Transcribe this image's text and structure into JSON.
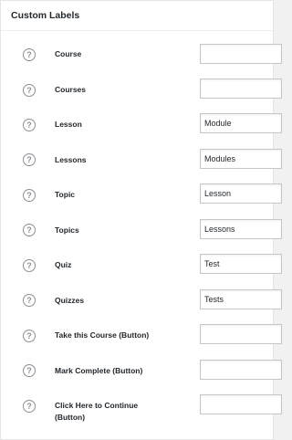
{
  "header": {
    "title": "Custom Labels"
  },
  "help_glyph": "?",
  "rows": [
    {
      "label": "Course",
      "value": ""
    },
    {
      "label": "Courses",
      "value": ""
    },
    {
      "label": "Lesson",
      "value": "Module"
    },
    {
      "label": "Lessons",
      "value": "Modules"
    },
    {
      "label": "Topic",
      "value": "Lesson"
    },
    {
      "label": "Topics",
      "value": "Lessons"
    },
    {
      "label": "Quiz",
      "value": "Test"
    },
    {
      "label": "Quizzes",
      "value": "Tests"
    },
    {
      "label": "Take this Course (Button)",
      "value": ""
    },
    {
      "label": "Mark Complete (Button)",
      "value": ""
    },
    {
      "label": "Click Here to Continue (Button)",
      "value": ""
    }
  ]
}
